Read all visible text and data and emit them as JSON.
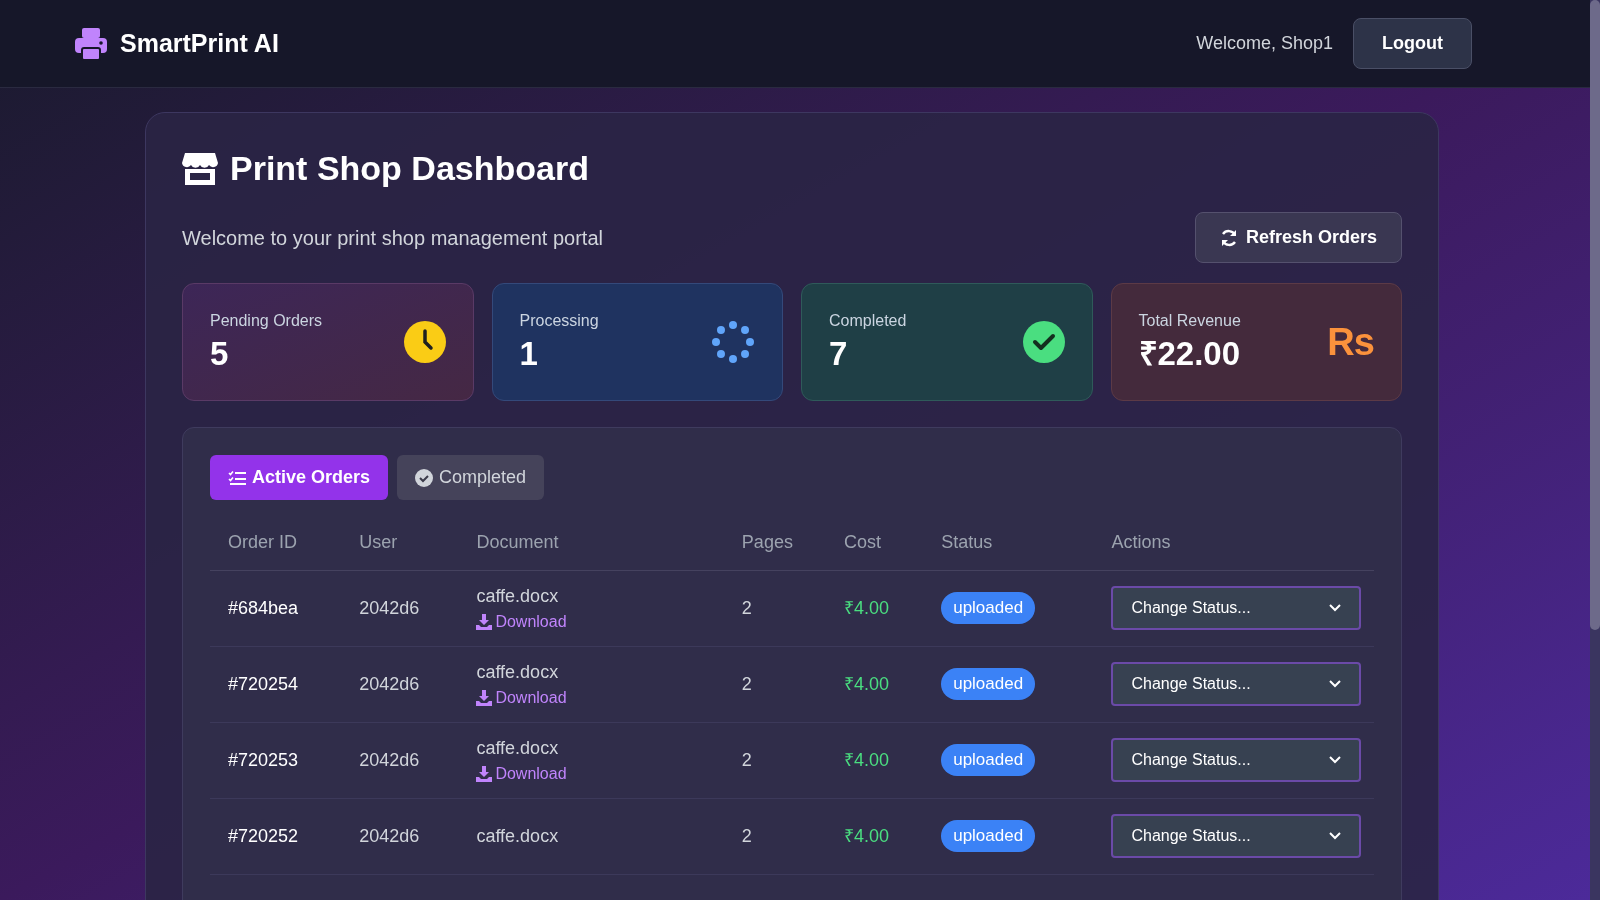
{
  "navbar": {
    "brand": "SmartPrint AI",
    "welcome": "Welcome, Shop1",
    "logout": "Logout"
  },
  "dashboard": {
    "title": "Print Shop Dashboard",
    "subtitle": "Welcome to your print shop management portal",
    "refresh": "Refresh Orders"
  },
  "stats": [
    {
      "kind": "pending",
      "label": "Pending Orders",
      "value": "5"
    },
    {
      "kind": "processing",
      "label": "Processing",
      "value": "1"
    },
    {
      "kind": "completed",
      "label": "Completed",
      "value": "7"
    },
    {
      "kind": "revenue",
      "label": "Total Revenue",
      "value": "₹22.00",
      "icon_text": "Rs"
    }
  ],
  "tabs": [
    {
      "kind": "list",
      "label": "Active Orders",
      "selected": true
    },
    {
      "kind": "check",
      "label": "Completed",
      "selected": false
    }
  ],
  "table": {
    "columns": [
      "Order ID",
      "User",
      "Document",
      "Pages",
      "Cost",
      "Status",
      "Actions"
    ],
    "rows": [
      {
        "order_id": "#684bea",
        "user": "2042d6",
        "document": "caffe.docx",
        "download": "Download",
        "pages": "2",
        "cost": "₹4.00",
        "status": "uploaded",
        "action": "Change Status..."
      },
      {
        "order_id": "#720254",
        "user": "2042d6",
        "document": "caffe.docx",
        "download": "Download",
        "pages": "2",
        "cost": "₹4.00",
        "status": "uploaded",
        "action": "Change Status..."
      },
      {
        "order_id": "#720253",
        "user": "2042d6",
        "document": "caffe.docx",
        "download": "Download",
        "pages": "2",
        "cost": "₹4.00",
        "status": "uploaded",
        "action": "Change Status..."
      },
      {
        "order_id": "#720252",
        "user": "2042d6",
        "document": "caffe.docx",
        "pages": "2",
        "cost": "₹4.00",
        "status": "uploaded",
        "action": "Change Status..."
      }
    ]
  }
}
